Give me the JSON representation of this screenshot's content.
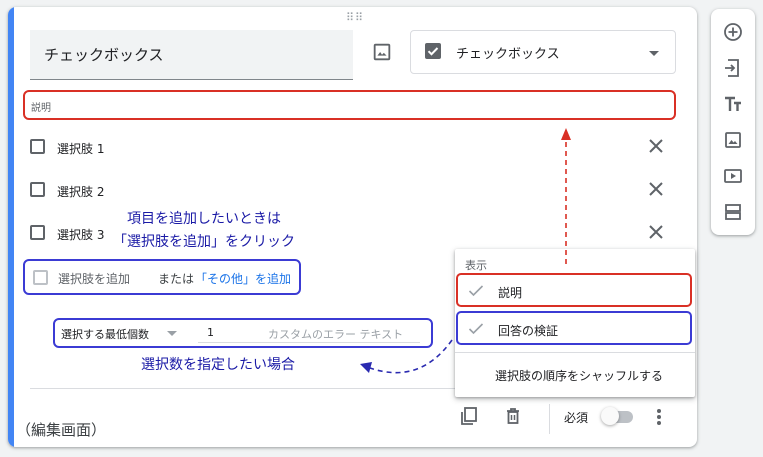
{
  "question": {
    "title": "チェックボックス",
    "type_label": "チェックボックス",
    "description_placeholder": "説明"
  },
  "options": [
    {
      "label": "選択肢 1"
    },
    {
      "label": "選択肢 2"
    },
    {
      "label": "選択肢 3"
    }
  ],
  "add_option": {
    "add_label": "選択肢を追加",
    "or_label": "または",
    "other_label": "「その他」を追加"
  },
  "validation": {
    "rule_label": "選択する最低個数",
    "count_value": "1",
    "error_placeholder": "カスタムのエラー テキスト"
  },
  "footer": {
    "required_label": "必須",
    "required_on": false
  },
  "annotations": {
    "add_note_line1": "項目を追加したいときは",
    "add_note_line2": "「選択肢を追加」をクリック",
    "validation_note": "選択数を指定したい場合",
    "edit_screen_label": "（編集画面）"
  },
  "menu": {
    "header": "表示",
    "items": [
      {
        "label": "説明",
        "checked": true
      },
      {
        "label": "回答の検証",
        "checked": true
      }
    ],
    "shuffle_label": "選択肢の順序をシャッフルする"
  },
  "sidebar_icons": [
    "add-question-icon",
    "import-questions-icon",
    "add-title-icon",
    "add-image-icon",
    "add-video-icon",
    "add-section-icon"
  ],
  "colors": {
    "accent": "#4285f4",
    "highlight_red": "#d93025",
    "highlight_blue": "#3b3bd4",
    "note_text": "#1a1aa6",
    "link": "#1a73e8"
  }
}
